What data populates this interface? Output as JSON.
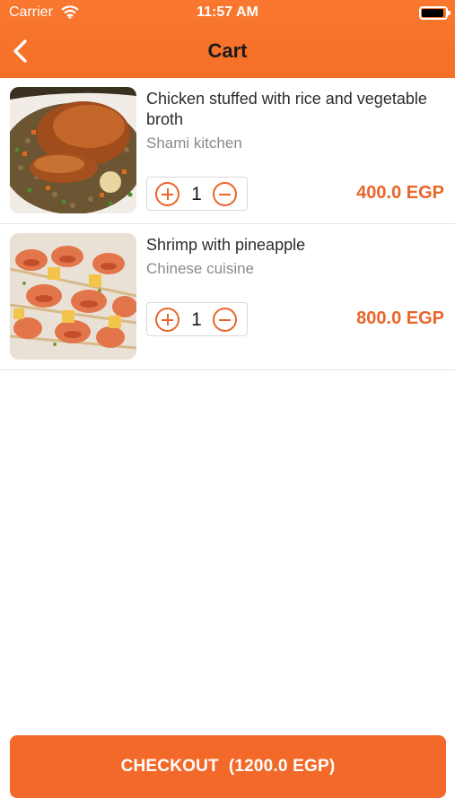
{
  "status_bar": {
    "carrier": "Carrier",
    "time": "11:57 AM"
  },
  "header": {
    "title": "Cart",
    "back_icon": "chevron-left-icon"
  },
  "cart_items": [
    {
      "name": "Chicken stuffed with rice and vegetable broth",
      "vendor": "Shami kitchen",
      "quantity": "1",
      "price": "400.0 EGP",
      "image": "roasted-chicken-on-rice"
    },
    {
      "name": "Shrimp with pineapple",
      "vendor": "Chinese cuisine",
      "quantity": "1",
      "price": "800.0 EGP",
      "image": "shrimp-pineapple-skewers"
    }
  ],
  "checkout": {
    "label": "CHECKOUT",
    "total": "(1200.0 EGP)"
  },
  "colors": {
    "accent": "#f2692a",
    "header": "#f57027",
    "price": "#ea6529"
  }
}
